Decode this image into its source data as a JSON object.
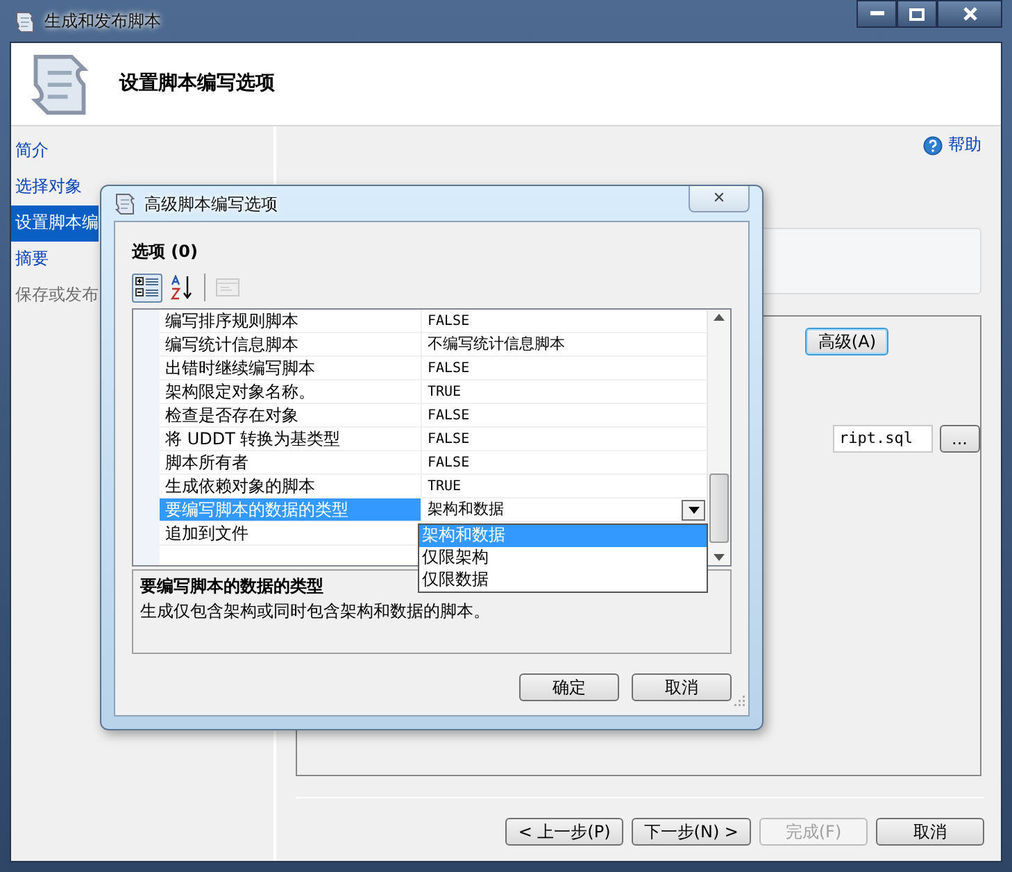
{
  "window": {
    "title": "生成和发布脚本"
  },
  "header": {
    "title": "设置脚本编写选项"
  },
  "sidebar": {
    "items": [
      {
        "label": "简介",
        "selected": false,
        "disabled": false
      },
      {
        "label": "选择对象",
        "selected": false,
        "disabled": false
      },
      {
        "label": "设置脚本编",
        "selected": true,
        "disabled": false
      },
      {
        "label": "摘要",
        "selected": false,
        "disabled": false
      },
      {
        "label": "保存或发布",
        "selected": false,
        "disabled": true
      }
    ]
  },
  "help": {
    "label": "帮助"
  },
  "panel": {
    "advanced_button": "高级(A)",
    "file_field": {
      "value": "ript.sql"
    },
    "browse_button": "..."
  },
  "footer": {
    "buttons": [
      {
        "label": "< 上一步(P)",
        "disabled": false
      },
      {
        "label": "下一步(N) >",
        "disabled": false
      },
      {
        "label": "完成(F)",
        "disabled": true
      },
      {
        "label": "取消",
        "disabled": false
      }
    ]
  },
  "dialog": {
    "title": "高级脚本编写选项",
    "close": "✕",
    "options_label": "选项 (0)",
    "toolbar": [
      {
        "kind": "categorized",
        "pressed": true,
        "disabled": false
      },
      {
        "kind": "alphabetical",
        "pressed": false,
        "disabled": false
      },
      {
        "kind": "pages",
        "pressed": false,
        "disabled": true
      }
    ],
    "properties": [
      {
        "name": "编写排序规则脚本",
        "value": "FALSE",
        "selected": false
      },
      {
        "name": "编写统计信息脚本",
        "value": "不编写统计信息脚本",
        "selected": false
      },
      {
        "name": "出错时继续编写脚本",
        "value": "FALSE",
        "selected": false
      },
      {
        "name": "架构限定对象名称。",
        "value": "TRUE",
        "selected": false
      },
      {
        "name": "检查是否存在对象",
        "value": "FALSE",
        "selected": false
      },
      {
        "name": "将 UDDT 转换为基类型",
        "value": "FALSE",
        "selected": false
      },
      {
        "name": "脚本所有者",
        "value": "FALSE",
        "selected": false
      },
      {
        "name": "生成依赖对象的脚本",
        "value": "TRUE",
        "selected": false
      },
      {
        "name": "要编写脚本的数据的类型",
        "value": "架构和数据",
        "selected": true
      },
      {
        "name": "追加到文件",
        "selected": false
      }
    ],
    "dropdown": {
      "options": [
        {
          "label": "架构和数据",
          "selected": true
        },
        {
          "label": "仅限架构",
          "selected": false
        },
        {
          "label": "仅限数据",
          "selected": false
        }
      ]
    },
    "description": {
      "title": "要编写脚本的数据的类型",
      "text": "生成仅包含架构或同时包含架构和数据的脚本。"
    },
    "buttons": [
      "确定",
      "取消"
    ]
  }
}
